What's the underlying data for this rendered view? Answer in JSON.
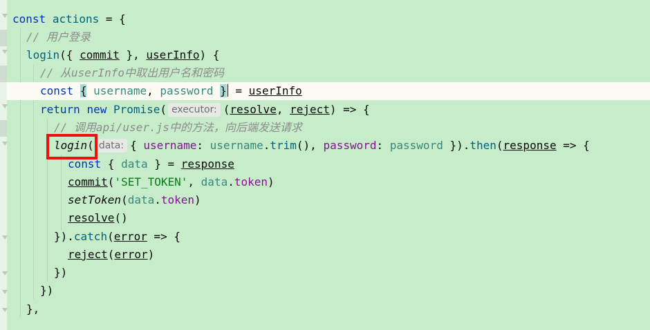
{
  "code": {
    "l1": {
      "kw": "const",
      "name": "actions",
      "rest": " = {"
    },
    "l2": {
      "comment": "// 用户登录"
    },
    "l3": {
      "fn": "login",
      "p1": "({ ",
      "commit": "commit",
      "p2": " }, ",
      "userInfo": "userInfo",
      "p3": ") {"
    },
    "l4": {
      "comment": "// 从userInfo中取出用户名和密码"
    },
    "l5": {
      "kw": "const",
      "open": "{",
      "username": "username",
      "comma": ", ",
      "password": "password",
      "close": "}",
      "eq": " = ",
      "userInfo": "userInfo"
    },
    "l6": {
      "kw1": "return",
      "kw2": "new",
      "cls": "Promise",
      "paren": "(",
      "hint": "executor:",
      "p1": "(",
      "resolve": "resolve",
      "comma": ", ",
      "reject": "reject",
      "rest": ") => {"
    },
    "l7": {
      "comment": "// 调用api/user.js中的方法，向后端发送请求"
    },
    "l8": {
      "login": "login",
      "paren": "(",
      "hint": "data:",
      "p1": "{ ",
      "k1": "username",
      "c1": ": ",
      "v1": "username",
      "dot1": ".",
      "m1": "trim",
      "p2": "(), ",
      "k2": "password",
      "c2": ": ",
      "v2": "password",
      "p3": " }).",
      "then": "then",
      "p4": "(",
      "response": "response",
      "rest": " => {"
    },
    "l9": {
      "kw": "const",
      "p1": " { ",
      "data": "data",
      "p2": " } = ",
      "response": "response"
    },
    "l10": {
      "commit": "commit",
      "p1": "(",
      "str": "'SET_TOKEN'",
      "p2": ", ",
      "data": "data",
      "dot": ".",
      "token": "token",
      "p3": ")"
    },
    "l11": {
      "fn": "setToken",
      "p1": "(",
      "data": "data",
      "dot": ".",
      "token": "token",
      "p2": ")"
    },
    "l12": {
      "resolve": "resolve",
      "p": "()"
    },
    "l13": {
      "p1": "}).",
      "catch": "catch",
      "p2": "(",
      "error": "error",
      "rest": " => {"
    },
    "l14": {
      "reject": "reject",
      "p1": "(",
      "error": "error",
      "p2": ")"
    },
    "l15": {
      "text": "})"
    },
    "l16": {
      "text": "})"
    },
    "l17": {
      "text": "},"
    }
  },
  "colors": {
    "editor_background": "#c6ecc9",
    "current_line": "#fbfbf3",
    "keyword": "#0033b3",
    "comment": "#8c8c8c",
    "string": "#067d17",
    "property": "#871094",
    "highlight_box": "#ee1111"
  }
}
